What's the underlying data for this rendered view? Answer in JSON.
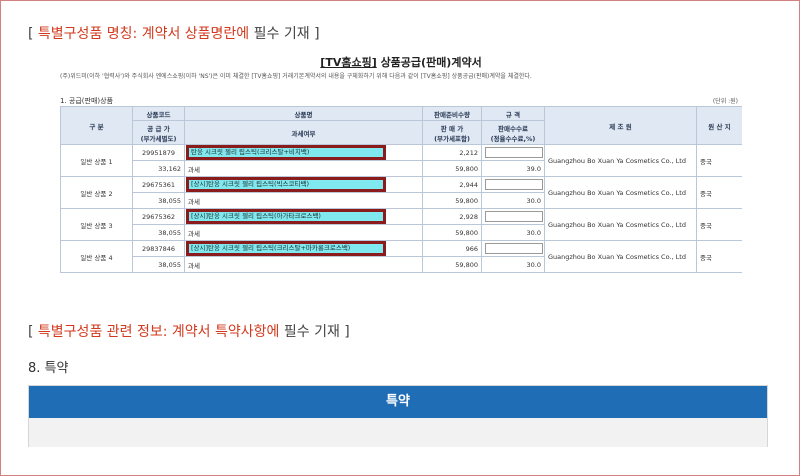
{
  "notice1": {
    "open": "[ ",
    "red": "특별구성품 명칭: 계약서 상품명란에",
    "rest": " 필수 기재 ]"
  },
  "doc": {
    "title_bracket": "[TV홈쇼핑]",
    "title_rest": " 상품공급(판매)계약서",
    "intro": "(주)위드미(이하 '협력사')와 주식회사 엔에스쇼핑(이하 'NS')은 이미 체결한 [TV홈쇼핑] 거래기본계약서의 내용을 구체화하기 위해 다음과 같이 [TV홈쇼핑] 상품공급(판매)계약을 체결한다.",
    "subtitle": "1. 공급(판매)상품",
    "unit": "(단위 :원)",
    "headers": {
      "division": "구 분",
      "product_code": "상품코드",
      "supply_price": "공 급 가",
      "supply_price_sub": "(부가세별도)",
      "product_name": "상품명",
      "tax_status": "과세여부",
      "sales_price_top": "판매준비수량",
      "sales_price": "판 매 가",
      "sales_price_sub": "(부가세포함)",
      "spec": "규 격",
      "fee": "판매수수료",
      "fee_sub": "(정율수수료,%)",
      "maker": "제 조 원",
      "origin": "원 산 지"
    },
    "rows": [
      {
        "division": "일반 상품 1",
        "code": "29951879",
        "supply": "33,162",
        "name": "탄웅 시크릿 젤리 립스틱(크리스탈+비치백)",
        "tax": "과세",
        "qty": "2,212",
        "price": "59,800",
        "fee": "39.0",
        "maker": "Guangzhou Bo Xuan Ya Cosmetics Co., Ltd",
        "origin": "중국"
      },
      {
        "division": "일반 상품 2",
        "code": "29675361",
        "supply": "38,055",
        "name": "[상시]탄웅 시크릿 젤리 립스틱(빅스코티백)",
        "tax": "과세",
        "qty": "2,944",
        "price": "59,800",
        "fee": "30.0",
        "maker": "Guangzhou Bo Xuan Ya Cosmetics Co., Ltd",
        "origin": "중국"
      },
      {
        "division": "일반 상품 3",
        "code": "29675362",
        "supply": "38,055",
        "name": "[상시]탄웅 시크릿 젤리 립스틱(아가타크로스백)",
        "tax": "과세",
        "qty": "2,928",
        "price": "59,800",
        "fee": "30.0",
        "maker": "Guangzhou Bo Xuan Ya Cosmetics Co., Ltd",
        "origin": "중국"
      },
      {
        "division": "일반 상품 4",
        "code": "29837846",
        "supply": "38,055",
        "name": "[상시]탄웅 시크릿 젤리 립스틱(크리스탈+마카롱크로스백)",
        "tax": "과세",
        "qty": "966",
        "price": "59,800",
        "fee": "30.0",
        "maker": "Guangzhou Bo Xuan Ya Cosmetics Co., Ltd",
        "origin": "중국"
      }
    ]
  },
  "notice2": {
    "open": "[ ",
    "red": "특별구성품 관련 정보: 계약서 특약사항에",
    "rest": " 필수 기재  ]"
  },
  "section": {
    "label": "8. 특약"
  },
  "special": {
    "header": "특약"
  },
  "colors": {
    "accent_red": "#d23a1e",
    "header_blue": "#1f6eb5",
    "highlight": "#80e8ef",
    "box_border": "#8b1c1c"
  }
}
